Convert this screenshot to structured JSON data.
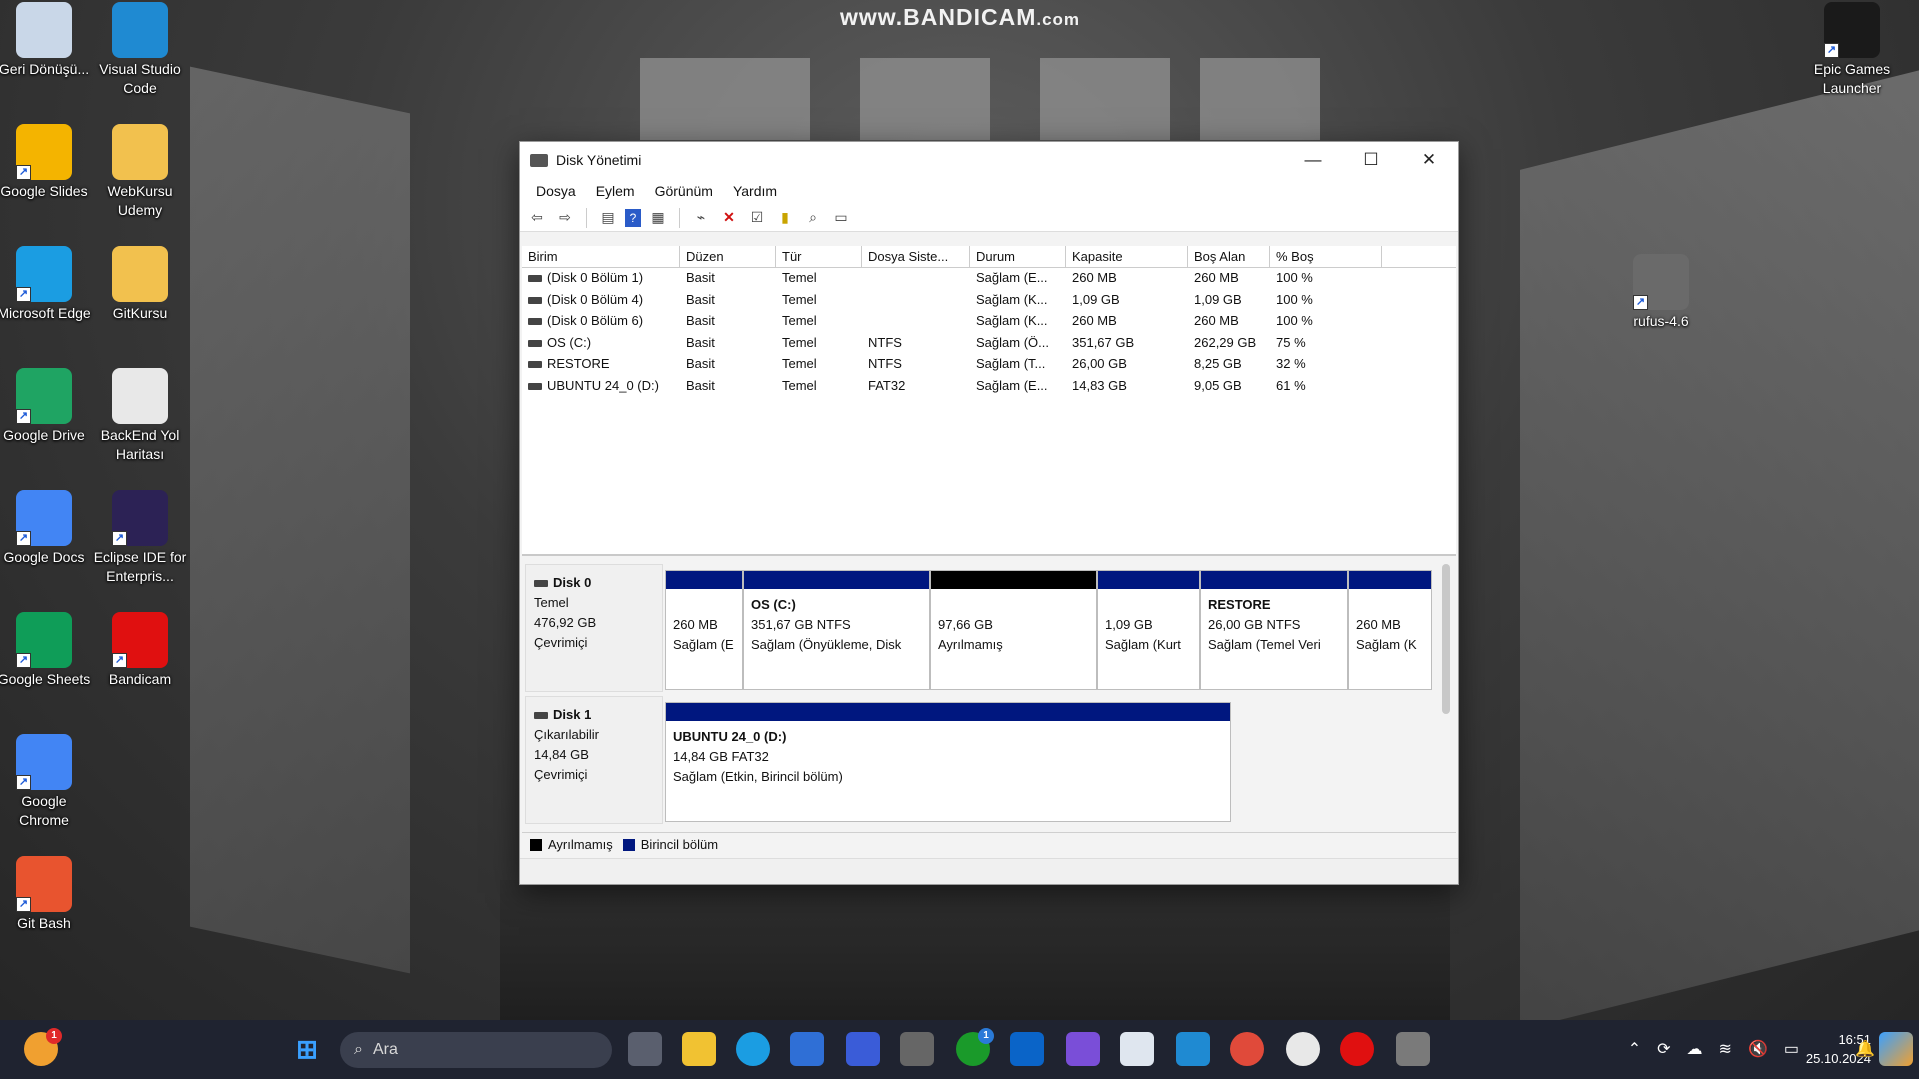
{
  "watermark": {
    "main": "www.BANDICAM",
    "suffix": ".com"
  },
  "desktop_icons": [
    {
      "label": "Geri Dönüşü...",
      "icon": "recycle-bin-icon",
      "color": "#c9d7e8"
    },
    {
      "label": "Visual Studio Code",
      "icon": "vscode-icon",
      "color": "#1f8ad2"
    },
    {
      "label": "Google Slides",
      "icon": "google-slides-icon",
      "color": "#f4b400"
    },
    {
      "label": "WebKursu Udemy",
      "icon": "folder-icon",
      "color": "#f2c14e"
    },
    {
      "label": "Microsoft Edge",
      "icon": "edge-icon",
      "color": "#1b9de2"
    },
    {
      "label": "GitKursu",
      "icon": "folder-icon",
      "color": "#f2c14e"
    },
    {
      "label": "Google Drive",
      "icon": "google-drive-icon",
      "color": "#1fa463"
    },
    {
      "label": "BackEnd Yol Haritası",
      "icon": "document-icon",
      "color": "#e8e8e8"
    },
    {
      "label": "Google Docs",
      "icon": "google-docs-icon",
      "color": "#4285f4"
    },
    {
      "label": "Eclipse IDE for Enterpris...",
      "icon": "eclipse-icon",
      "color": "#2c2255"
    },
    {
      "label": "Google Sheets",
      "icon": "google-sheets-icon",
      "color": "#0f9d58"
    },
    {
      "label": "Bandicam",
      "icon": "bandicam-icon",
      "color": "#e01010"
    },
    {
      "label": "Google Chrome",
      "icon": "chrome-icon",
      "color": "#4285f4"
    },
    {
      "label": "Git Bash",
      "icon": "git-bash-icon",
      "color": "#e8542f"
    },
    {
      "label": "Epic Games Launcher",
      "icon": "epic-games-icon",
      "color": "#1a1a1a"
    },
    {
      "label": "rufus-4.6",
      "icon": "rufus-icon",
      "color": "#6a6a6a"
    }
  ],
  "window": {
    "title": "Disk Yönetimi",
    "controls": {
      "minimize": "—",
      "maximize": "☐",
      "close": "✕"
    },
    "menu": [
      "Dosya",
      "Eylem",
      "Görünüm",
      "Yardım"
    ],
    "toolbar_icons": [
      "back-icon",
      "forward-icon",
      "properties-icon",
      "help-icon",
      "view-icon",
      "connect-icon",
      "delete-icon",
      "check-icon",
      "import-icon",
      "search-icon",
      "settings-icon"
    ]
  },
  "volume_table": {
    "columns": [
      "Birim",
      "Düzen",
      "Tür",
      "Dosya Siste...",
      "Durum",
      "Kapasite",
      "Boş Alan",
      "% Boş"
    ],
    "rows": [
      [
        "(Disk 0 Bölüm 1)",
        "Basit",
        "Temel",
        "",
        "Sağlam (E...",
        "260 MB",
        "260 MB",
        "100 %"
      ],
      [
        "(Disk 0 Bölüm 4)",
        "Basit",
        "Temel",
        "",
        "Sağlam (K...",
        "1,09 GB",
        "1,09 GB",
        "100 %"
      ],
      [
        "(Disk 0 Bölüm 6)",
        "Basit",
        "Temel",
        "",
        "Sağlam (K...",
        "260 MB",
        "260 MB",
        "100 %"
      ],
      [
        "OS (C:)",
        "Basit",
        "Temel",
        "NTFS",
        "Sağlam (Ö...",
        "351,67 GB",
        "262,29 GB",
        "75 %"
      ],
      [
        "RESTORE",
        "Basit",
        "Temel",
        "NTFS",
        "Sağlam (T...",
        "26,00 GB",
        "8,25 GB",
        "32 %"
      ],
      [
        "UBUNTU 24_0 (D:)",
        "Basit",
        "Temel",
        "FAT32",
        "Sağlam (E...",
        "14,83 GB",
        "9,05 GB",
        "61 %"
      ]
    ]
  },
  "disks": [
    {
      "name": "Disk 0",
      "type": "Temel",
      "size": "476,92 GB",
      "status": "Çevrimiçi",
      "partitions": [
        {
          "title": "",
          "line1": "260 MB",
          "line2": "Sağlam (E",
          "kind": "primary"
        },
        {
          "title": "OS  (C:)",
          "line1": "351,67 GB NTFS",
          "line2": "Sağlam (Önyükleme, Disk",
          "kind": "primary"
        },
        {
          "title": "",
          "line1": "97,66 GB",
          "line2": "Ayrılmamış",
          "kind": "unallocated"
        },
        {
          "title": "",
          "line1": "1,09 GB",
          "line2": "Sağlam (Kurt",
          "kind": "primary"
        },
        {
          "title": "RESTORE",
          "line1": "26,00 GB NTFS",
          "line2": "Sağlam (Temel Veri",
          "kind": "primary"
        },
        {
          "title": "",
          "line1": "260 MB",
          "line2": "Sağlam (K",
          "kind": "primary"
        }
      ]
    },
    {
      "name": "Disk 1",
      "type": "Çıkarılabilir",
      "size": "14,84 GB",
      "status": "Çevrimiçi",
      "partitions": [
        {
          "title": "UBUNTU 24_0  (D:)",
          "line1": "14,84 GB FAT32",
          "line2": "Sağlam (Etkin, Birincil bölüm)",
          "kind": "primary"
        }
      ]
    }
  ],
  "legend": [
    {
      "label": "Ayrılmamış",
      "color": "#000000"
    },
    {
      "label": "Birincil bölüm",
      "color": "#00177f"
    }
  ],
  "taskbar": {
    "search_placeholder": "Ara",
    "notification_badge": "1",
    "xbox_badge": "1",
    "time": "16:51",
    "date": "25.10.2024",
    "apps": [
      "start-icon",
      "task-view-icon",
      "file-explorer-icon",
      "edge-icon",
      "store-icon",
      "code-editor-icon",
      "obs-icon",
      "xbox-icon",
      "outlook-icon",
      "copilot-icon",
      "notepad-icon",
      "vscode-icon",
      "chrome-icon",
      "clock-app-icon",
      "bandicam-icon",
      "disk-management-icon"
    ]
  }
}
